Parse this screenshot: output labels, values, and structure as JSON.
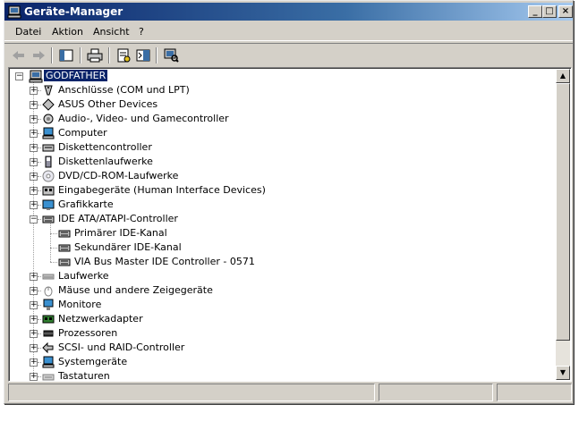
{
  "window": {
    "title": "Geräte-Manager",
    "minimize": "_",
    "maximize": "□",
    "close": "×"
  },
  "menu": [
    "Datei",
    "Aktion",
    "Ansicht",
    "?"
  ],
  "toolbar": [
    "back-icon",
    "forward-icon",
    "console-tree-icon",
    "print-icon",
    "properties-icon",
    "help-icon",
    "scan-hardware-icon"
  ],
  "tree": {
    "root": "GODFATHER",
    "items": [
      {
        "label": "Anschlüsse (COM und LPT)",
        "icon": "port-icon",
        "expander": "+"
      },
      {
        "label": "ASUS Other Devices",
        "icon": "asus-device-icon",
        "expander": "+"
      },
      {
        "label": "Audio-, Video- und Gamecontroller",
        "icon": "sound-icon",
        "expander": "+"
      },
      {
        "label": "Computer",
        "icon": "computer-icon",
        "expander": "+"
      },
      {
        "label": "Diskettencontroller",
        "icon": "floppy-controller-icon",
        "expander": "+"
      },
      {
        "label": "Diskettenlaufwerke",
        "icon": "floppy-drive-icon",
        "expander": "+"
      },
      {
        "label": "DVD/CD-ROM-Laufwerke",
        "icon": "cdrom-icon",
        "expander": "+"
      },
      {
        "label": "Eingabegeräte (Human Interface Devices)",
        "icon": "hid-icon",
        "expander": "+"
      },
      {
        "label": "Grafikkarte",
        "icon": "display-adapter-icon",
        "expander": "+"
      },
      {
        "label": "IDE ATA/ATAPI-Controller",
        "icon": "ide-controller-icon",
        "expander": "−"
      },
      {
        "label": "Primärer IDE-Kanal",
        "icon": "ide-channel-icon",
        "child": true
      },
      {
        "label": "Sekundärer IDE-Kanal",
        "icon": "ide-channel-icon",
        "child": true
      },
      {
        "label": "VIA Bus Master IDE Controller - 0571",
        "icon": "ide-channel-icon",
        "child": true
      },
      {
        "label": "Laufwerke",
        "icon": "disk-drive-icon",
        "expander": "+"
      },
      {
        "label": "Mäuse und andere Zeigegeräte",
        "icon": "mouse-icon",
        "expander": "+"
      },
      {
        "label": "Monitore",
        "icon": "monitor-icon",
        "expander": "+"
      },
      {
        "label": "Netzwerkadapter",
        "icon": "network-adapter-icon",
        "expander": "+"
      },
      {
        "label": "Prozessoren",
        "icon": "processor-icon",
        "expander": "+"
      },
      {
        "label": "SCSI- und RAID-Controller",
        "icon": "scsi-icon",
        "expander": "+"
      },
      {
        "label": "Systemgeräte",
        "icon": "system-device-icon",
        "expander": "+"
      },
      {
        "label": "Tastaturen",
        "icon": "keyboard-icon",
        "expander": "+"
      }
    ]
  },
  "scrollbar": {
    "up": "▲",
    "down": "▼"
  },
  "colors": {
    "selection": "#0a246a",
    "titlebar_start": "#0a246a",
    "titlebar_end": "#a6caf0",
    "face": "#d4d0c8"
  }
}
